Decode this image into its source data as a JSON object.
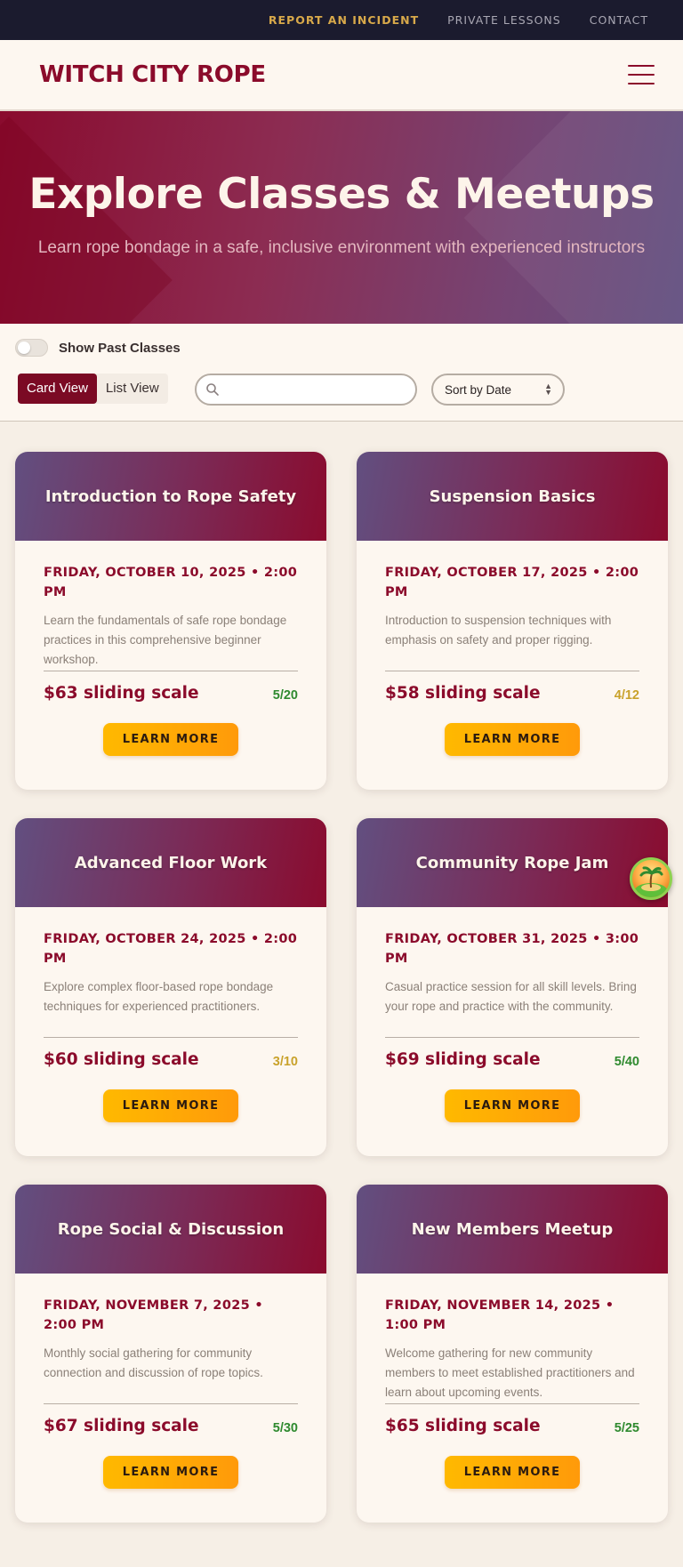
{
  "utility_nav": {
    "items": [
      {
        "label": "REPORT AN INCIDENT",
        "accent": true
      },
      {
        "label": "PRIVATE LESSONS",
        "accent": false
      },
      {
        "label": "CONTACT",
        "accent": false
      }
    ]
  },
  "header": {
    "logo": "WITCH CITY ROPE",
    "menu_icon": "hamburger-menu-icon"
  },
  "hero": {
    "title": "Explore Classes & Meetups",
    "subtitle": "Learn rope bondage in a safe, inclusive environment with experienced instructors"
  },
  "filters": {
    "show_past_label": "Show Past Classes",
    "show_past_enabled": false,
    "views": [
      "Card View",
      "List View"
    ],
    "active_view": "Card View",
    "search": {
      "value": "",
      "placeholder": ""
    },
    "sort": {
      "selected": "Sort by Date"
    }
  },
  "colors": {
    "brand": "#8b0b2b",
    "accent_button": "#ffb900",
    "status_available": "#2f8a2f",
    "status_limited": "#c9a22b"
  },
  "events": [
    {
      "title": "Introduction to Rope Safety",
      "date": "FRIDAY, OCTOBER 10, 2025 • 2:00 PM",
      "description": "Learn the fundamentals of safe rope bondage practices in this comprehensive beginner workshop.",
      "price": "$63 sliding scale",
      "capacity": "5/20",
      "capacity_status": "available",
      "button": "LEARN MORE"
    },
    {
      "title": "Suspension Basics",
      "date": "FRIDAY, OCTOBER 17, 2025 • 2:00 PM",
      "description": "Introduction to suspension techniques with emphasis on safety and proper rigging.",
      "price": "$58 sliding scale",
      "capacity": "4/12",
      "capacity_status": "limited",
      "button": "LEARN MORE"
    },
    {
      "title": "Advanced Floor Work",
      "date": "FRIDAY, OCTOBER 24, 2025 • 2:00 PM",
      "description": "Explore complex floor-based rope bondage techniques for experienced practitioners.",
      "price": "$60 sliding scale",
      "capacity": "3/10",
      "capacity_status": "limited",
      "button": "LEARN MORE"
    },
    {
      "title": "Community Rope Jam",
      "date": "FRIDAY, OCTOBER 31, 2025 • 3:00 PM",
      "description": "Casual practice session for all skill levels. Bring your rope and practice with the community.",
      "price": "$69 sliding scale",
      "capacity": "5/40",
      "capacity_status": "available",
      "button": "LEARN MORE"
    },
    {
      "title": "Rope Social & Discussion",
      "date": "FRIDAY, NOVEMBER 7, 2025 • 2:00 PM",
      "description": "Monthly social gathering for community connection and discussion of rope topics.",
      "price": "$67 sliding scale",
      "capacity": "5/30",
      "capacity_status": "available",
      "button": "LEARN MORE"
    },
    {
      "title": "New Members Meetup",
      "date": "FRIDAY, NOVEMBER 14, 2025 • 1:00 PM",
      "description": "Welcome gathering for new community members to meet established practitioners and learn about upcoming events.",
      "price": "$65 sliding scale",
      "capacity": "5/25",
      "capacity_status": "available",
      "button": "LEARN MORE"
    }
  ],
  "floating_widget": {
    "icon": "tropical-island-avatar-icon"
  }
}
